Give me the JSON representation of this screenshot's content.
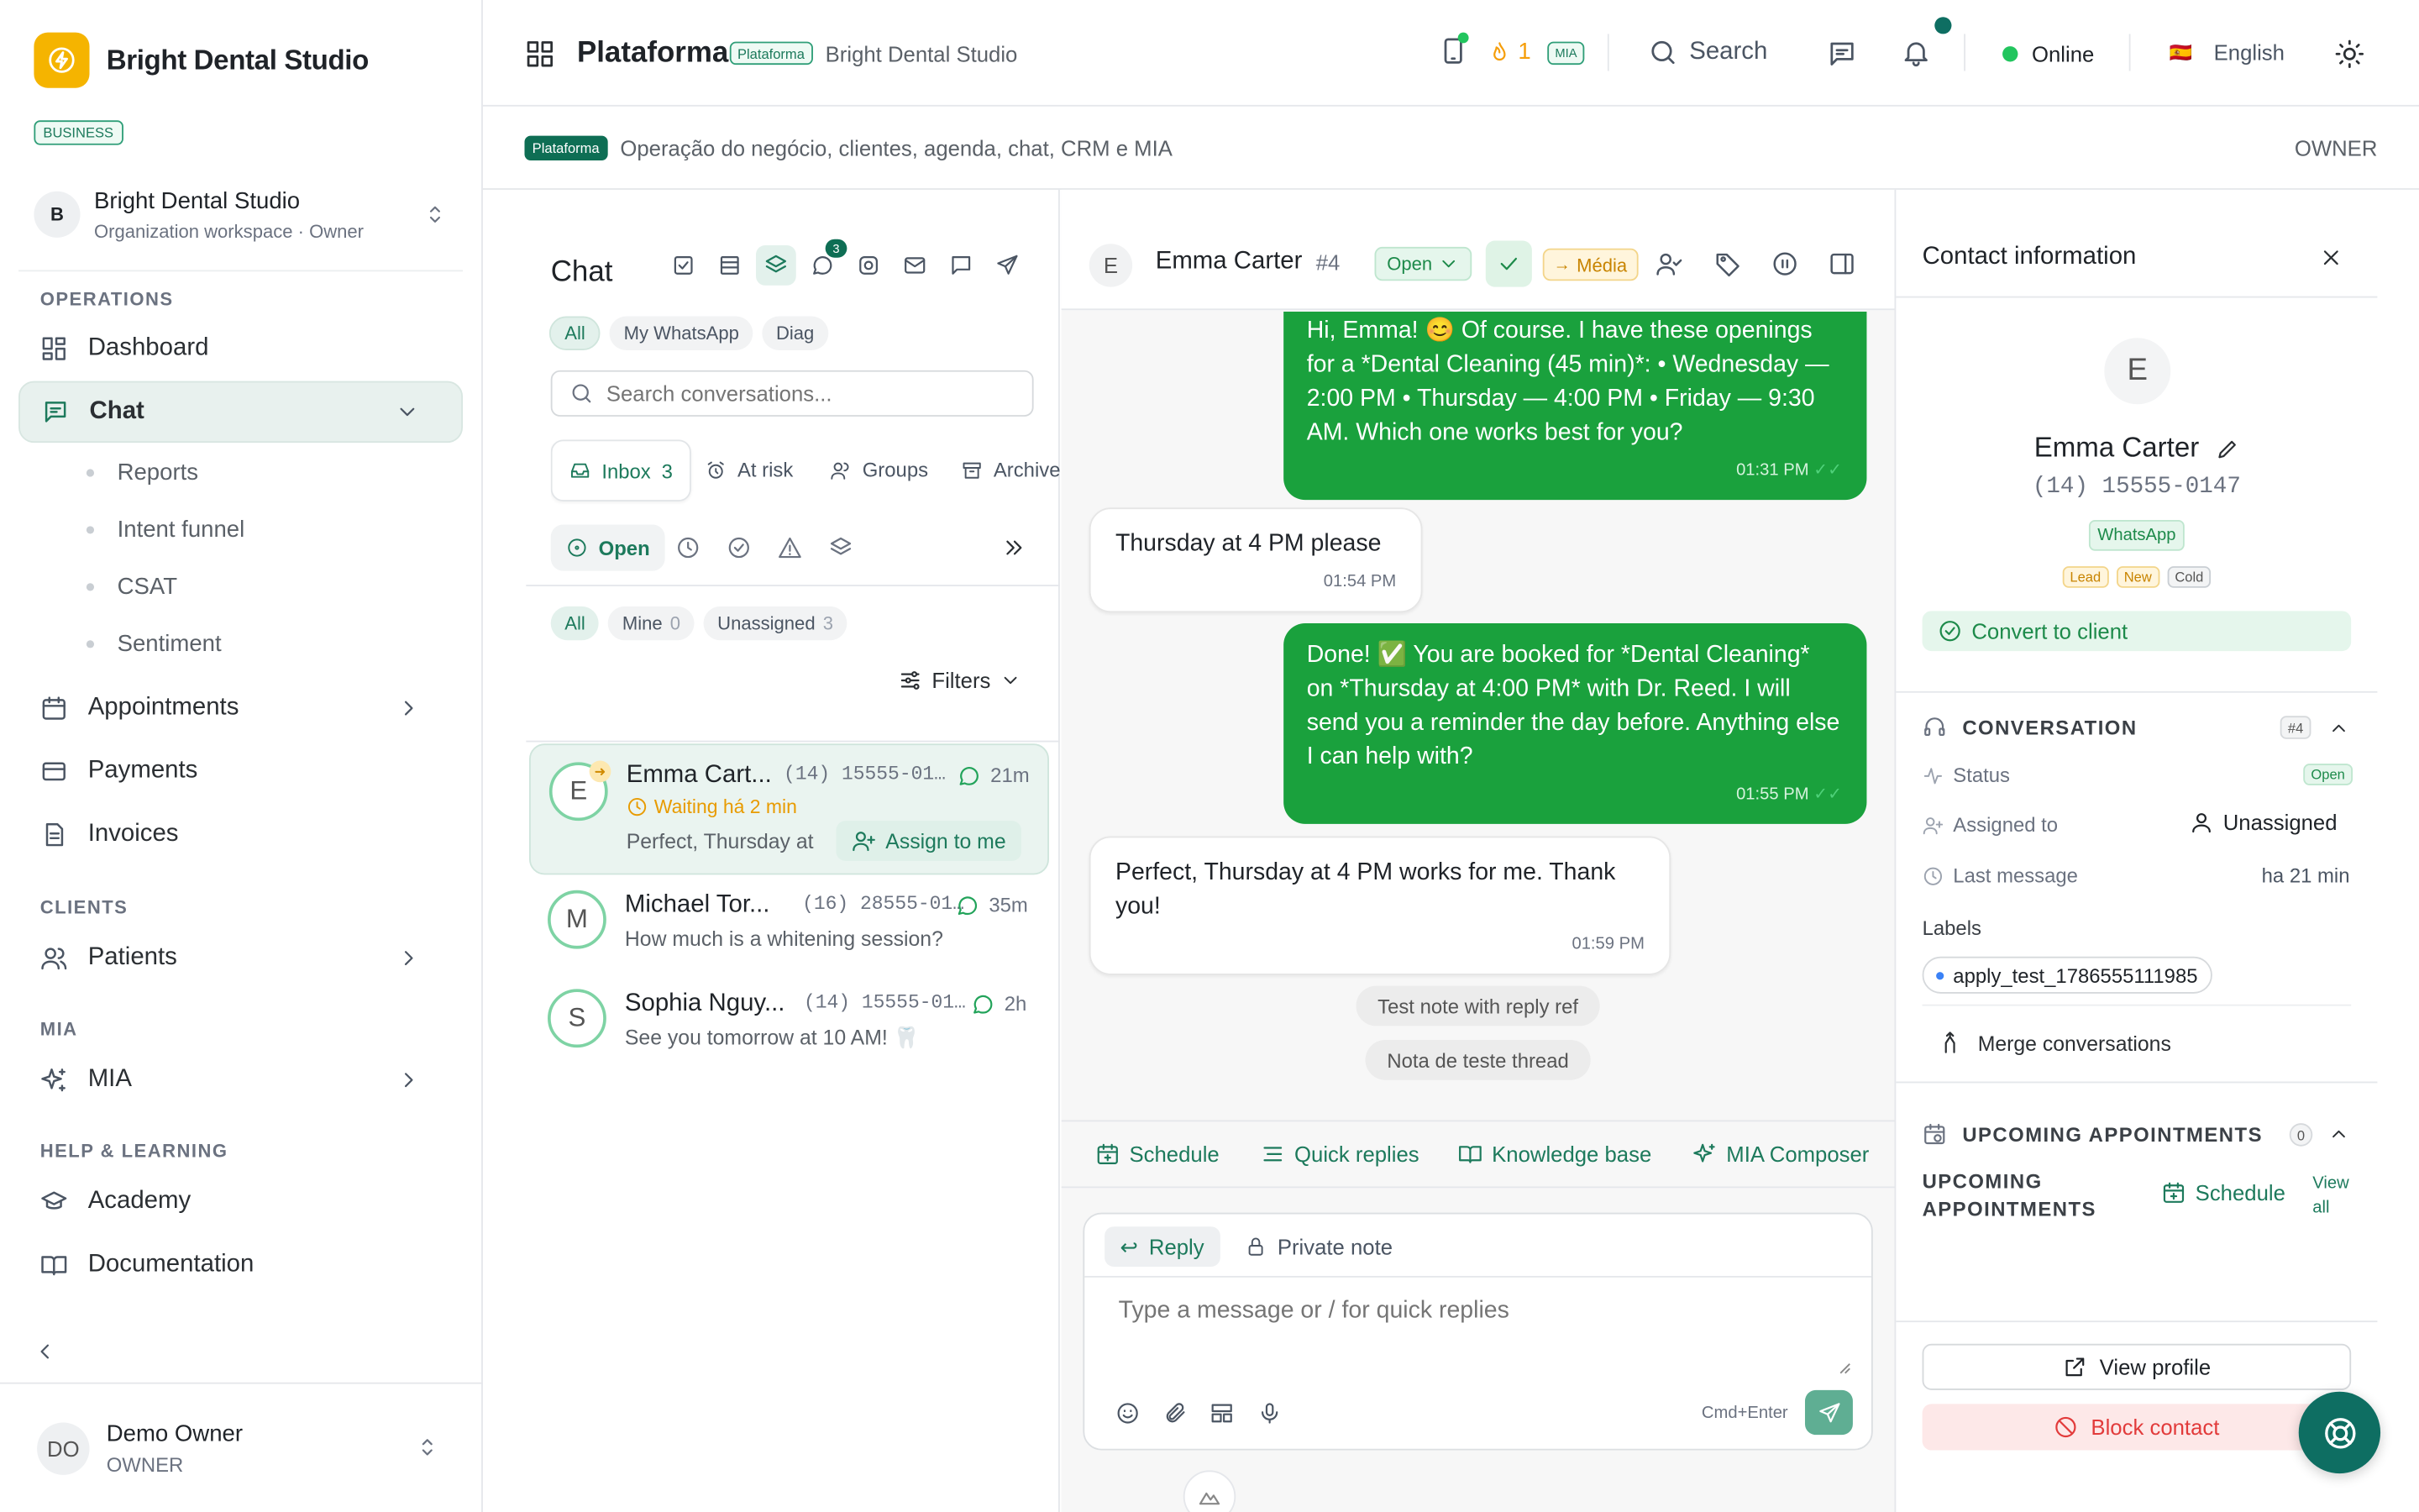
{
  "sidebar": {
    "brand": "Bright Dental Studio",
    "plan_badge": "BUSINESS",
    "org": {
      "avatar": "B",
      "name": "Bright Dental Studio",
      "subtitle": "Organization workspace · Owner"
    },
    "sections": {
      "operations": "OPERATIONS",
      "clients": "CLIENTS",
      "mia": "MIA",
      "help": "HELP & LEARNING"
    },
    "items": {
      "dashboard": "Dashboard",
      "chat": "Chat",
      "reports": "Reports",
      "intent_funnel": "Intent funnel",
      "csat": "CSAT",
      "sentiment": "Sentiment",
      "appointments": "Appointments",
      "payments": "Payments",
      "invoices": "Invoices",
      "patients": "Patients",
      "mia": "MIA",
      "academy": "Academy",
      "documentation": "Documentation"
    },
    "user": {
      "initials": "DO",
      "name": "Demo Owner",
      "role": "OWNER"
    }
  },
  "header": {
    "title": "Plataforma",
    "badge": "Plataforma",
    "org": "Bright Dental Studio",
    "streak": "1",
    "mia_badge": "MIA",
    "search": "Search",
    "status": "Online",
    "language": "English",
    "flag": "🇪🇸"
  },
  "subbar": {
    "badge": "Plataforma",
    "description": "Operação do negócio, clientes, agenda, chat, CRM e MIA",
    "role": "OWNER"
  },
  "chatlist": {
    "title": "Chat",
    "chat_badge": "3",
    "channel_filters": [
      "All",
      "My WhatsApp",
      "Diag"
    ],
    "search_placeholder": "Search conversations...",
    "tabs": {
      "inbox": "Inbox",
      "inbox_count": "3",
      "at_risk": "At risk",
      "groups": "Groups",
      "archive": "Archive"
    },
    "status_filter": "Open",
    "assign_filters": {
      "all": "All",
      "mine": "Mine",
      "mine_count": "0",
      "unassigned": "Unassigned",
      "unassigned_count": "3"
    },
    "filters_label": "Filters",
    "conversations": [
      {
        "initial": "E",
        "name": "Emma Cart...",
        "phone": "(14) 15555-01…",
        "time": "21m",
        "waiting": "Waiting há 2 min",
        "preview": "Perfect, Thursday at",
        "assign": "Assign to me"
      },
      {
        "initial": "M",
        "name": "Michael Tor...",
        "phone": "(16) 28555-01…",
        "time": "35m",
        "preview": "How much is a whitening session?"
      },
      {
        "initial": "S",
        "name": "Sophia Nguy...",
        "phone": "(14) 15555-01…",
        "time": "2h",
        "preview": "See you tomorrow at 10 AM! 🦷"
      }
    ]
  },
  "chat": {
    "contact_initial": "E",
    "contact_name": "Emma Carter",
    "contact_id": "#4",
    "status": "Open",
    "priority": "Média",
    "messages": [
      {
        "dir": "out",
        "text": "Hi, Emma! 😊 Of course. I have these openings for a *Dental Cleaning (45 min)*: • Wednesday — 2:00 PM • Thursday — 4:00 PM • Friday — 9:30 AM. Which one works best for you?",
        "time": "01:31 PM"
      },
      {
        "dir": "in",
        "text": "Thursday at 4 PM please",
        "time": "01:54 PM"
      },
      {
        "dir": "out",
        "text": "Done! ✅ You are booked for *Dental Cleaning* on *Thursday at 4:00 PM* with Dr. Reed. I will send you a reminder the day before. Anything else I can help with?",
        "time": "01:55 PM"
      },
      {
        "dir": "in",
        "text": "Perfect, Thursday at 4 PM works for me. Thank you!",
        "time": "01:59 PM"
      }
    ],
    "notes": [
      "Test note with reply ref",
      "Nota de teste thread"
    ],
    "quick_actions": {
      "schedule": "Schedule",
      "quick_replies": "Quick replies",
      "knowledge_base": "Knowledge base",
      "mia_composer": "MIA Composer"
    },
    "composer": {
      "reply_tab": "Reply",
      "private_tab": "Private note",
      "placeholder": "Type a message or / for quick replies",
      "shortcut": "Cmd+Enter"
    }
  },
  "contact_panel": {
    "title": "Contact information",
    "initial": "E",
    "name": "Emma Carter",
    "phone": "(14) 15555-0147",
    "channel": "WhatsApp",
    "tags": [
      "Lead",
      "New",
      "Cold"
    ],
    "convert": "Convert to client",
    "conversation": {
      "heading": "CONVERSATION",
      "id_badge": "#4",
      "status_label": "Status",
      "status_value": "Open",
      "assigned_label": "Assigned to",
      "assigned_value": "Unassigned",
      "last_label": "Last message",
      "last_value": "ha 21 min",
      "labels_title": "Labels",
      "label_chip": "apply_test_1786555111985",
      "merge": "Merge conversations"
    },
    "appointments": {
      "heading": "UPCOMING APPOINTMENTS",
      "count": "0",
      "subheading": "UPCOMING APPOINTMENTS",
      "schedule": "Schedule",
      "view_all": "View all"
    },
    "view_profile": "View profile",
    "block": "Block contact"
  },
  "colors": {
    "brand_green": "#1aa13d",
    "accent_teal": "#1d7a5c",
    "logo_yellow": "#f5b400",
    "danger": "#e23b3b"
  }
}
